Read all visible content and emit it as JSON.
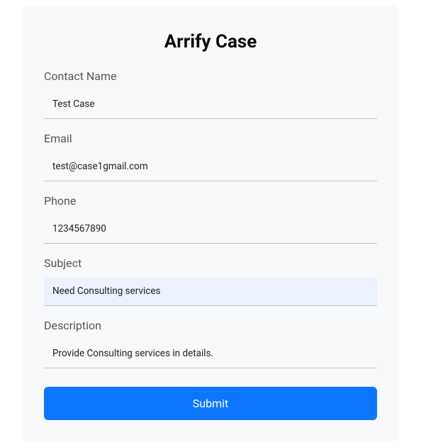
{
  "form": {
    "title": "Arrify Case",
    "fields": {
      "contact_name": {
        "label": "Contact Name",
        "value": "Test Case"
      },
      "email": {
        "label": "Email",
        "value": "test@case1gmail.com"
      },
      "phone": {
        "label": "Phone",
        "value": "1234567890"
      },
      "subject": {
        "label": "Subject",
        "value": "Need Consulting services"
      },
      "description": {
        "label": "Description",
        "value": "Provide Consulting services in details."
      }
    },
    "submit_label": "Submit"
  }
}
